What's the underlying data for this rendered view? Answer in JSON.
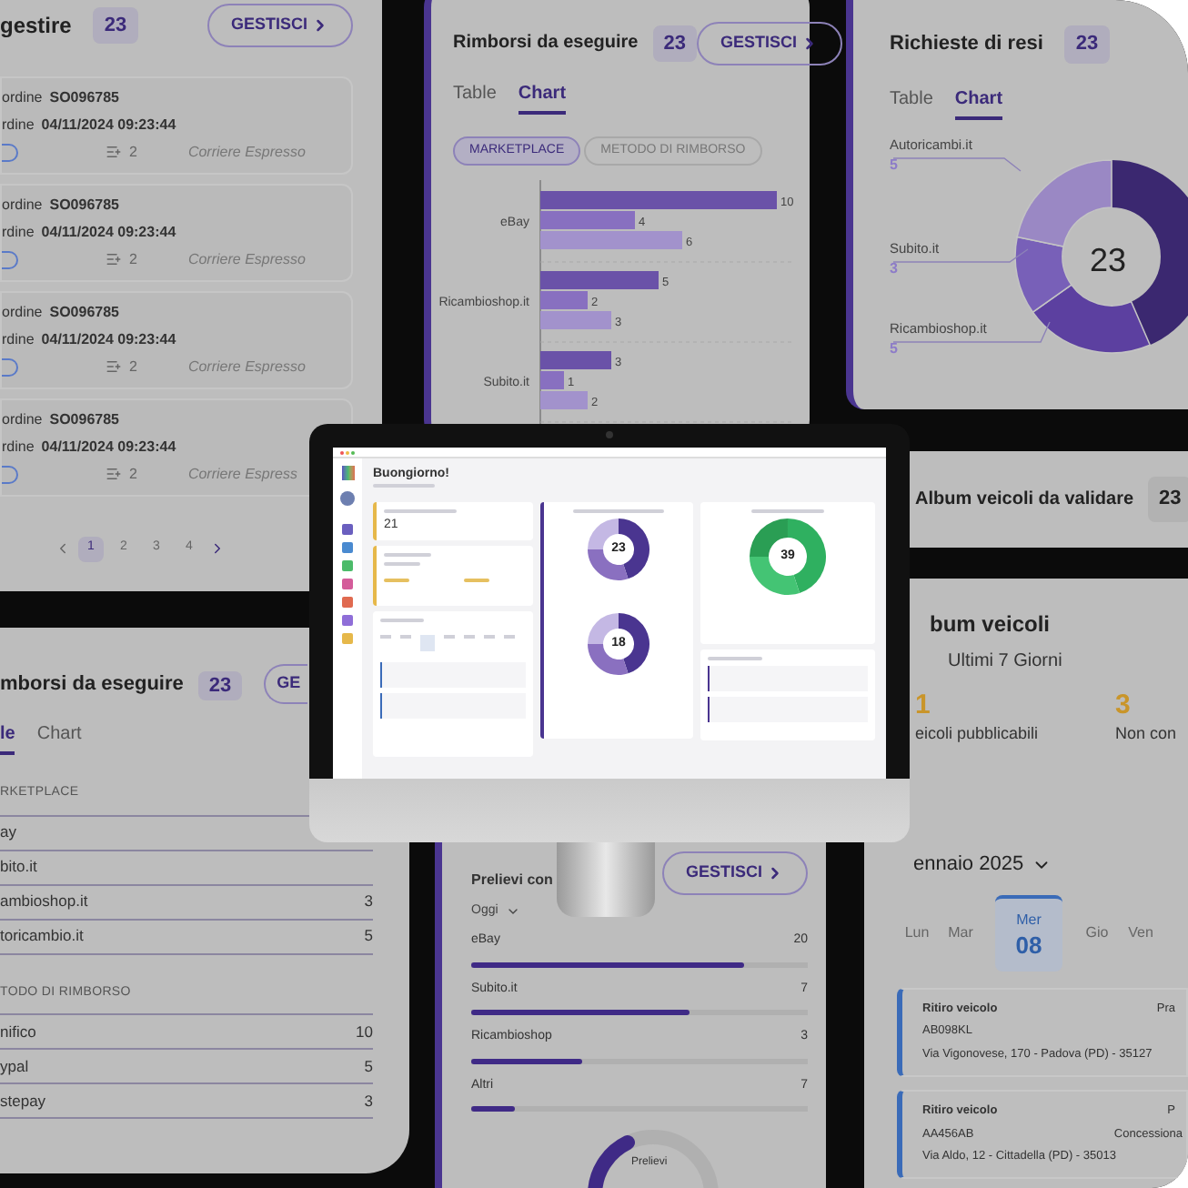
{
  "orders_card": {
    "title": "gestire",
    "count": "23",
    "button": "GESTISCI",
    "orders": [
      {
        "order_label": "ordine",
        "order_no": "SO096785",
        "date_label": "rdine",
        "date": "04/11/2024 09:23:44",
        "items": "2",
        "carrier": "Corriere Espresso"
      },
      {
        "order_label": "ordine",
        "order_no": "SO096785",
        "date_label": "rdine",
        "date": "04/11/2024 09:23:44",
        "items": "2",
        "carrier": "Corriere Espresso"
      },
      {
        "order_label": "ordine",
        "order_no": "SO096785",
        "date_label": "rdine",
        "date": "04/11/2024 09:23:44",
        "items": "2",
        "carrier": "Corriere Espresso"
      },
      {
        "order_label": "ordine",
        "order_no": "SO096785",
        "date_label": "rdine",
        "date": "04/11/2024 09:23:44",
        "items": "2",
        "carrier": "Corriere Espress"
      }
    ],
    "pagination": [
      {
        "label": "1",
        "selected": true
      },
      {
        "label": "2",
        "selected": false
      },
      {
        "label": "3",
        "selected": false
      },
      {
        "label": "4",
        "selected": false
      }
    ]
  },
  "refunds_chart_card": {
    "title": "Rimborsi da eseguire",
    "count": "23",
    "button": "GESTISCI",
    "tabs": [
      {
        "label": "Table",
        "selected": false
      },
      {
        "label": "Chart",
        "selected": true
      }
    ],
    "filters": [
      {
        "label": "MARKETPLACE",
        "selected": true
      },
      {
        "label": "METODO DI RIMBORSO",
        "selected": false
      }
    ],
    "chart_data": {
      "type": "bar",
      "orientation": "horizontal",
      "categories": [
        "eBay",
        "Ricambioshop.it",
        "Subito.it"
      ],
      "data_labels": true,
      "series": [
        {
          "color": "#6a52a8",
          "values": [
            10,
            5,
            3
          ]
        },
        {
          "color": "#8870c0",
          "values": [
            4,
            2,
            1
          ]
        },
        {
          "color": "#a292cc",
          "values": [
            6,
            3,
            2
          ]
        }
      ]
    }
  },
  "returns_card": {
    "title": "Richieste di resi",
    "count": "23",
    "tabs": [
      {
        "label": "Table",
        "selected": false
      },
      {
        "label": "Chart",
        "selected": true
      }
    ],
    "total": "23",
    "legend": [
      {
        "label": "Autoricambi.it",
        "value": "5"
      },
      {
        "label": "Subito.it",
        "value": "3"
      },
      {
        "label": "Ricambioshop.it",
        "value": "5"
      }
    ]
  },
  "album_validate_card": {
    "title": "Album veicoli da validare",
    "count": "23"
  },
  "album_card": {
    "title": "bum veicoli",
    "subtitle": "Ultimi 7 Giorni",
    "stats": [
      {
        "value": "1",
        "label": "eicoli pubblicabili"
      },
      {
        "value": "3",
        "label": "Non con"
      }
    ]
  },
  "refunds_table_card": {
    "title": "mborsi da eseguire",
    "count": "23",
    "button": "GE",
    "tabs": [
      {
        "label": "le",
        "selected": true
      },
      {
        "label": "Chart",
        "selected": false
      }
    ],
    "groups": [
      {
        "heading": "RKETPLACE",
        "rows": [
          {
            "name": "ay"
          },
          {
            "name": "bito.it"
          },
          {
            "name": "ambioshop.it",
            "value": "3"
          },
          {
            "name": "toricambio.it",
            "value": "5"
          }
        ]
      },
      {
        "heading": "TODO DI RIMBORSO",
        "rows": [
          {
            "name": "nifico",
            "value": "10"
          },
          {
            "name": "ypal",
            "value": "5"
          },
          {
            "name": "stepay",
            "value": "3"
          }
        ]
      }
    ]
  },
  "withdrawals_card": {
    "title": "Prelievi con",
    "button": "GESTISCI",
    "period": "Oggi",
    "rows": [
      {
        "name": "eBay",
        "value": "20",
        "level": 0.81
      },
      {
        "name": "Subito.it",
        "value": "7",
        "level": 0.65
      },
      {
        "name": "Ricambioshop",
        "value": "3",
        "level": 0.33
      },
      {
        "name": "Altri",
        "value": "7",
        "level": 0.13
      }
    ],
    "gauge_label": "Prelievi"
  },
  "calendar_card": {
    "month": "ennaio 2025",
    "days": [
      {
        "name": "Lun",
        "selected": false
      },
      {
        "name": "Mar",
        "selected": false
      },
      {
        "name": "Mer",
        "date": "08",
        "selected": true
      },
      {
        "name": "Gio",
        "selected": false
      },
      {
        "name": "Ven",
        "selected": false
      }
    ],
    "events": [
      {
        "title": "Ritiro veicolo",
        "type": "Pra",
        "plate": "AB098KL",
        "address": "Via Vigonovese, 170 - Padova (PD) - 35127"
      },
      {
        "title": "Ritiro veicolo",
        "type": "P",
        "plate": "AA456AB",
        "place": "Concessiona",
        "address": "Via Aldo, 12 - Cittadella (PD) - 35013"
      }
    ]
  },
  "monitor": {
    "greeting": "Buongiorno!",
    "album_count": "21",
    "refunds_total": "23",
    "refunds_method_total": "18",
    "downloads_total": "39"
  }
}
